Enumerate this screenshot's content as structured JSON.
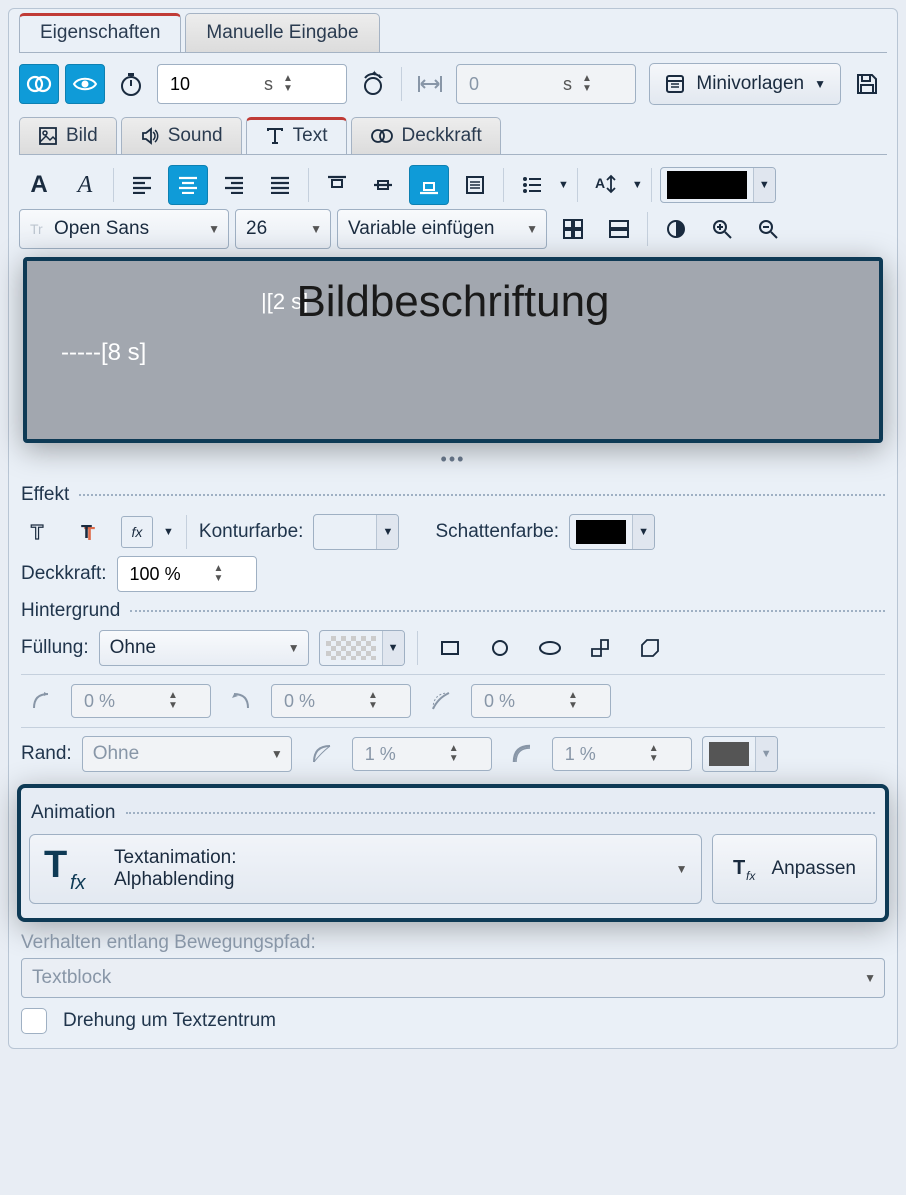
{
  "tabs": {
    "properties": "Eigenschaften",
    "manual": "Manuelle Eingabe"
  },
  "toolbar": {
    "duration_value": "10",
    "duration_unit": "s",
    "width_value": "0",
    "width_unit": "s",
    "minivorlagen": "Minivorlagen"
  },
  "subtabs": {
    "bild": "Bild",
    "sound": "Sound",
    "text": "Text",
    "deckkraft": "Deckkraft"
  },
  "text_tools": {
    "font": "Open Sans",
    "size": "26",
    "variable": "Variable einfügen"
  },
  "preview": {
    "caption": "Bildbeschriftung",
    "marker1": "|[2 s]",
    "marker2": "-----[8 s]"
  },
  "effect": {
    "title": "Effekt",
    "konturfarbe_lbl": "Konturfarbe:",
    "kontur_color": "#000000",
    "schattenfarbe_lbl": "Schattenfarbe:",
    "schatten_color": "#000000",
    "deckkraft_lbl": "Deckkraft:",
    "deckkraft_value": "100 %"
  },
  "hintergrund": {
    "title": "Hintergrund",
    "fuellung_lbl": "Füllung:",
    "fuellung_value": "Ohne",
    "corner1": "0 %",
    "corner2": "0 %",
    "corner3": "0 %",
    "rand_lbl": "Rand:",
    "rand_value": "Ohne",
    "rand_w1": "1 %",
    "rand_w2": "1 %",
    "rand_color": "#555555"
  },
  "animation": {
    "title": "Animation",
    "line1": "Textanimation:",
    "line2": "Alphablending",
    "anpassen": "Anpassen"
  },
  "path": {
    "lbl": "Verhalten entlang Bewegungspfad:",
    "value": "Textblock",
    "rotation": "Drehung um Textzentrum"
  }
}
